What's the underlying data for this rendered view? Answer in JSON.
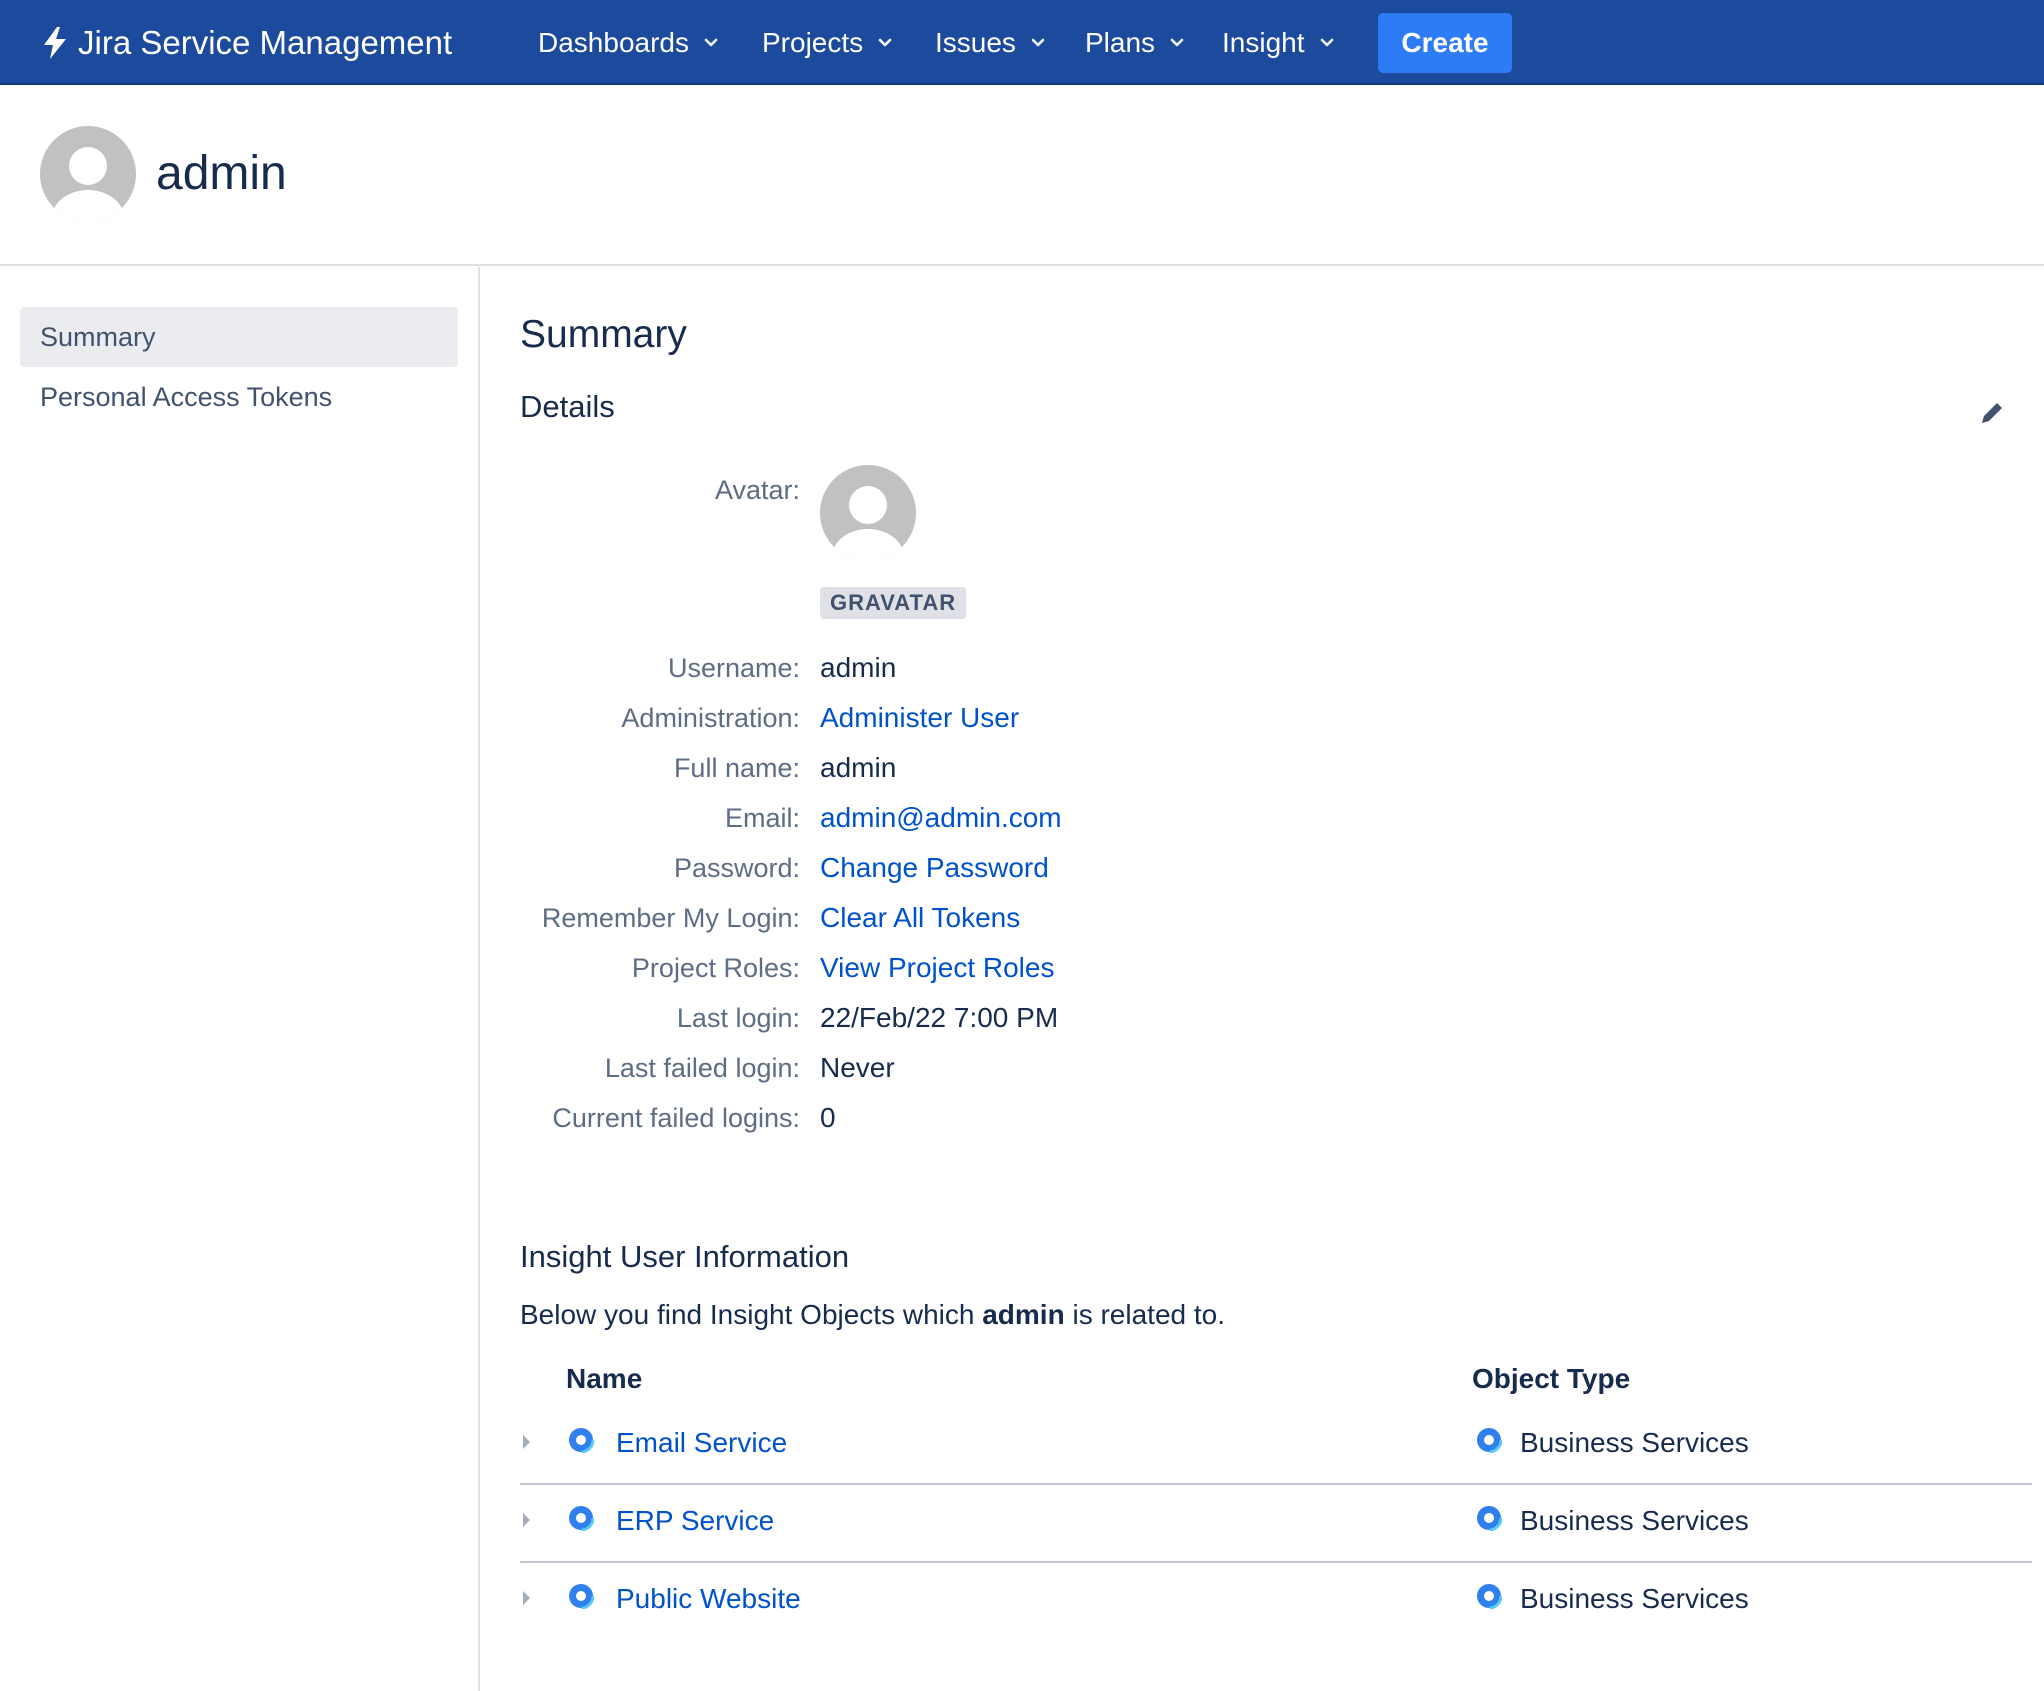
{
  "nav": {
    "brand": "Jira Service Management",
    "items": [
      {
        "label": "Dashboards"
      },
      {
        "label": "Projects"
      },
      {
        "label": "Issues"
      },
      {
        "label": "Plans"
      },
      {
        "label": "Insight"
      }
    ],
    "create_label": "Create"
  },
  "header": {
    "username": "admin"
  },
  "sidebar": {
    "items": [
      {
        "label": "Summary",
        "active": true
      },
      {
        "label": "Personal Access Tokens",
        "active": false
      }
    ]
  },
  "main": {
    "title": "Summary",
    "details_title": "Details",
    "avatar_label": "Avatar:",
    "gravatar_label": "GRAVATAR",
    "fields": [
      {
        "label": "Username:",
        "value": "admin",
        "link": false
      },
      {
        "label": "Administration:",
        "value": "Administer User",
        "link": true
      },
      {
        "label": "Full name:",
        "value": "admin",
        "link": false
      },
      {
        "label": "Email:",
        "value": "admin@admin.com",
        "link": true
      },
      {
        "label": "Password:",
        "value": "Change Password",
        "link": true
      },
      {
        "label": "Remember My Login:",
        "value": "Clear All Tokens",
        "link": true
      },
      {
        "label": "Project Roles:",
        "value": "View Project Roles",
        "link": true
      },
      {
        "label": "Last login:",
        "value": "22/Feb/22 7:00 PM",
        "link": false
      },
      {
        "label": "Last failed login:",
        "value": "Never",
        "link": false
      },
      {
        "label": "Current failed logins:",
        "value": "0",
        "link": false
      }
    ]
  },
  "insight": {
    "title": "Insight User Information",
    "desc_before": "Below you find Insight Objects which ",
    "desc_user": "admin",
    "desc_after": " is related to.",
    "col_name": "Name",
    "col_type": "Object Type",
    "rows": [
      {
        "name": "Email Service",
        "type": "Business Services"
      },
      {
        "name": "ERP Service",
        "type": "Business Services"
      },
      {
        "name": "Public Website",
        "type": "Business Services"
      }
    ]
  },
  "colors": {
    "nav_bg": "#1c4a9c",
    "create_bg": "#2d7bf5",
    "link": "#0052cc",
    "text": "#172b4d",
    "label": "#5e6c84"
  }
}
